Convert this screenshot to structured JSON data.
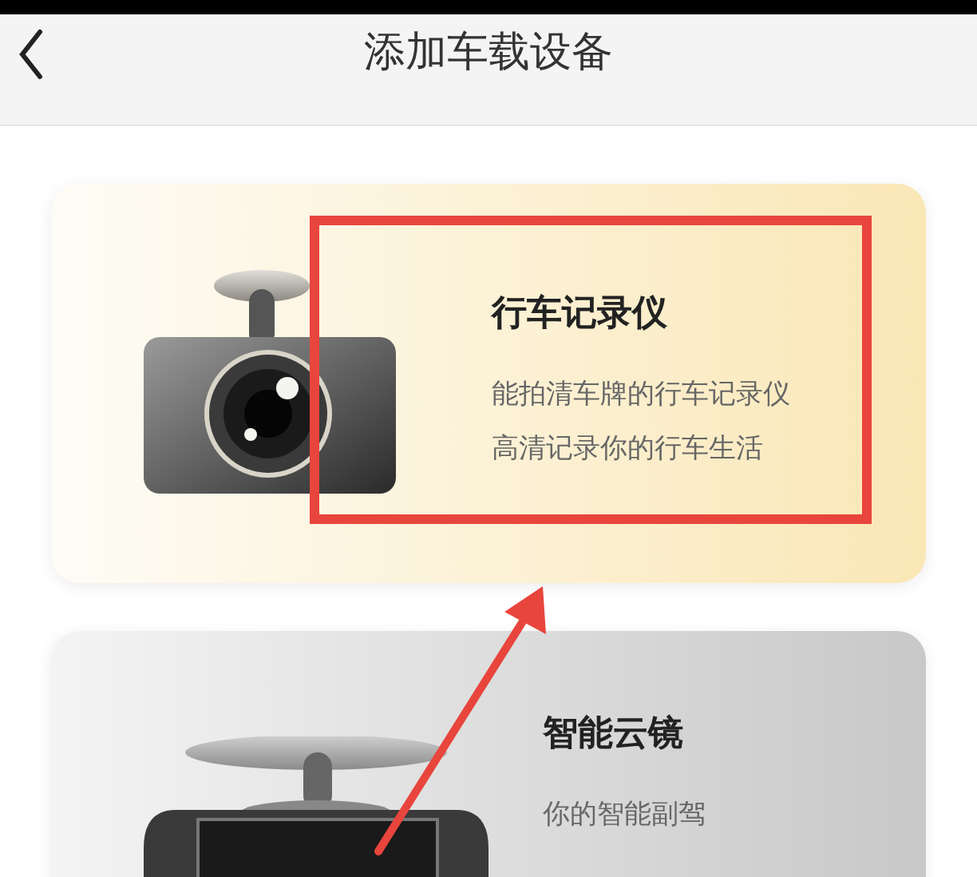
{
  "header": {
    "title": "添加车载设备"
  },
  "devices": [
    {
      "kind": "dashcam",
      "name": "行车记录仪",
      "lines": [
        "能拍清车牌的行车记录仪",
        "高清记录你的行车生活"
      ]
    },
    {
      "kind": "mirror",
      "name": "智能云镜",
      "lines": [
        "你的智能副驾"
      ]
    }
  ]
}
